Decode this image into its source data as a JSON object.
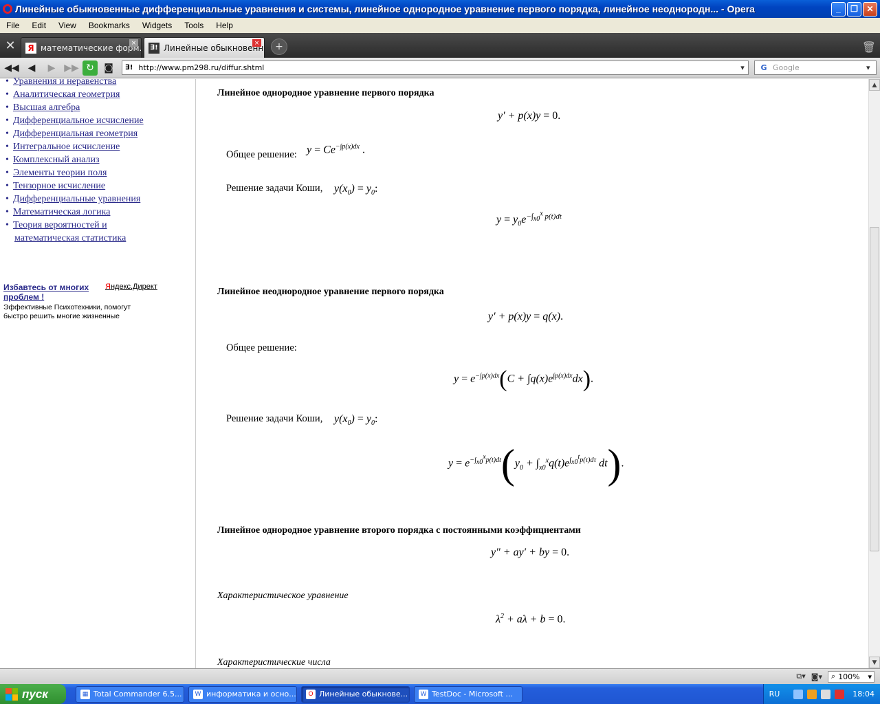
{
  "window": {
    "title": "Линейные обыкновенные дифференциальные уравнения и системы, линейное однородное уравнение первого порядка, линейное неоднородн... - Opera"
  },
  "menu": [
    "File",
    "Edit",
    "View",
    "Bookmarks",
    "Widgets",
    "Tools",
    "Help"
  ],
  "tabs": [
    {
      "label": "математические форм...",
      "favicon": "Я",
      "active": false
    },
    {
      "label": "Линейные обыкновенн...",
      "favicon": "∃!",
      "active": true
    }
  ],
  "address": {
    "url": "http://www.pm298.ru/diffur.shtml",
    "site_icon": "∃!"
  },
  "search": {
    "placeholder": "Google"
  },
  "sidebar": {
    "items": [
      "Уравнения и неравенства",
      "Аналитическая геометрия",
      "Высшая алгебра",
      "Дифференциальное исчисление",
      "Дифференциальная геометрия",
      "Интегральное исчисление",
      "Комплексный анализ",
      "Элементы теории поля",
      "Тензорное исчисление",
      "Дифференциальные уравнения",
      "Математическая логика",
      "Теория вероятностей и"
    ],
    "item_cont": "математическая статистика",
    "ad_heading": "Избавтесь от многих проблем !",
    "ad_source_first": "Я",
    "ad_source_rest": "ндекс.Директ",
    "ad_text": "Эффективные Психотехники, помогут быстро решить многие жизненные"
  },
  "content": {
    "h1": "Линейное однородное уравнение первого порядка",
    "h2": "Линейное неоднородное уравнение первого порядка",
    "h3": "Линейное однородное уравнение второго порядка с постоянными коэффициентами",
    "general_solution": "Общее решение:",
    "cauchy": "Решение задачи Коши,",
    "char_eq": "Характеристическое уравнение",
    "char_nums": "Характеристические числа"
  },
  "status": {
    "zoom": "100%"
  },
  "taskbar": {
    "start": "пуск",
    "tasks": [
      "Total Commander 6.5...",
      "информатика и осно...",
      "Линейные обыкнове...",
      "TestDoc - Microsoft ..."
    ],
    "lang": "RU",
    "clock": "18:04"
  }
}
